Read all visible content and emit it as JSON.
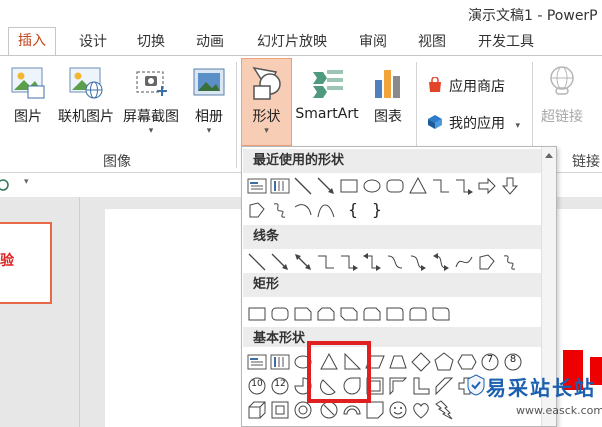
{
  "window": {
    "title": "演示文稿1 - PowerP"
  },
  "tabs": [
    {
      "label": "插入",
      "active": true
    },
    {
      "label": "设计"
    },
    {
      "label": "切换"
    },
    {
      "label": "动画"
    },
    {
      "label": "幻灯片放映"
    },
    {
      "label": "审阅"
    },
    {
      "label": "视图"
    },
    {
      "label": "开发工具"
    }
  ],
  "ribbon": {
    "images_group": {
      "label": "图像",
      "buttons": [
        {
          "label": "图片",
          "icon": "picture-icon"
        },
        {
          "label": "联机图片",
          "icon": "online-picture-icon"
        },
        {
          "label": "屏幕截图",
          "icon": "screenshot-icon",
          "dropdown": "▾"
        },
        {
          "label": "相册",
          "icon": "photo-album-icon",
          "dropdown": "▾"
        }
      ]
    },
    "illustrations": {
      "shapes": {
        "label": "形状",
        "dropdown": "▾"
      },
      "smartart": {
        "label": "SmartArt"
      },
      "chart": {
        "label": "图表"
      }
    },
    "apps": {
      "store": {
        "label": "应用商店"
      },
      "my_apps": {
        "label": "我的应用",
        "dropdown": "▾"
      }
    },
    "links": {
      "hyperlink": {
        "label": "超链接"
      },
      "group_label": "链接"
    }
  },
  "gallery": {
    "sections": [
      {
        "title": "最近使用的形状"
      },
      {
        "title": "线条"
      },
      {
        "title": "矩形"
      },
      {
        "title": "基本形状"
      }
    ],
    "braces": {
      "open": "{",
      "close": "}"
    },
    "numbered_shapes": [
      "7",
      "8",
      "10",
      "12"
    ]
  },
  "slide_thumbnail": {
    "text": "验"
  },
  "watermark": {
    "brand": "易采站长站",
    "url": "www.easck.com"
  },
  "colors": {
    "accent": "#c4451c",
    "selected_button": "#f8cdb5",
    "highlight_box": "#e02020"
  }
}
